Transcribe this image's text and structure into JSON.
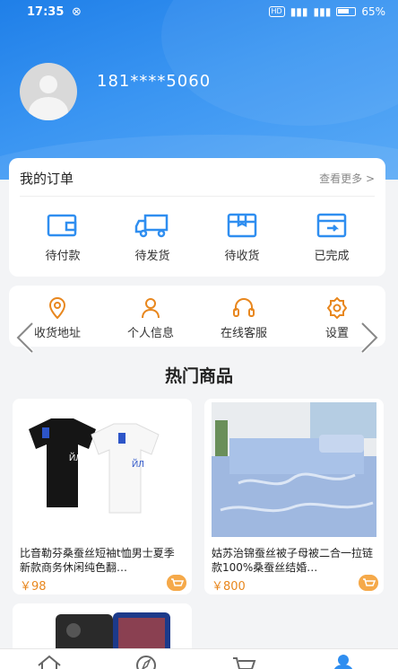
{
  "status_bar": {
    "time": "17:35",
    "battery": "65%"
  },
  "profile": {
    "phone": "181****5060"
  },
  "orders": {
    "title": "我的订单",
    "more": "查看更多 >",
    "items": [
      {
        "label": "待付款",
        "icon": "wallet-icon"
      },
      {
        "label": "待发货",
        "icon": "truck-icon"
      },
      {
        "label": "待收货",
        "icon": "box-icon"
      },
      {
        "label": "已完成",
        "icon": "completed-box-icon"
      }
    ]
  },
  "services": {
    "items": [
      {
        "label": "收货地址",
        "icon": "location-icon"
      },
      {
        "label": "个人信息",
        "icon": "person-icon"
      },
      {
        "label": "在线客服",
        "icon": "headset-icon"
      },
      {
        "label": "设置",
        "icon": "gear-icon"
      }
    ]
  },
  "hot": {
    "title": "热门商品",
    "products": [
      {
        "name": "比音勒芬桑蚕丝短袖t恤男士夏季新款商务休闲纯色翻…",
        "price": "￥98"
      },
      {
        "name": "姑苏治锦蚕丝被子母被二合一拉链款100%桑蚕丝结婚…",
        "price": "￥800"
      }
    ]
  },
  "colors": {
    "accent": "#2f8ef0",
    "price": "#e8871e"
  }
}
